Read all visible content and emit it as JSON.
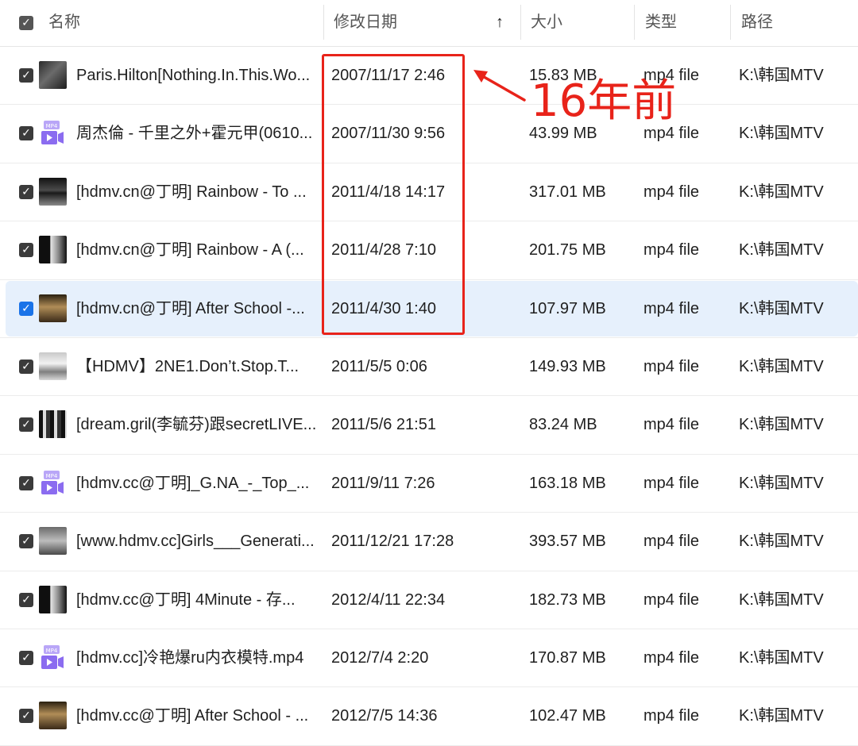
{
  "header": {
    "name": "名称",
    "date": "修改日期",
    "sort_arrow": "↑",
    "size": "大小",
    "type": "类型",
    "path": "路径"
  },
  "rows": [
    {
      "name": "Paris.Hilton[Nothing.In.This.Wo...",
      "date": "2007/11/17 2:46",
      "size": "15.83 MB",
      "type": "mp4 file",
      "path": "K:\\韩国MTV",
      "thumb": "dark",
      "selected": false
    },
    {
      "name": "周杰倫 - 千里之外+霍元甲(0610...",
      "date": "2007/11/30 9:56",
      "size": "43.99 MB",
      "type": "mp4 file",
      "path": "K:\\韩国MTV",
      "thumb": "video-file-icon",
      "selected": false
    },
    {
      "name": "[hdmv.cn@丁明] Rainbow - To ...",
      "date": "2011/4/18 14:17",
      "size": "317.01 MB",
      "type": "mp4 file",
      "path": "K:\\韩国MTV",
      "thumb": "stage",
      "selected": false
    },
    {
      "name": "[hdmv.cn@丁明] Rainbow - A (...",
      "date": "2011/4/28 7:10",
      "size": "201.75 MB",
      "type": "mp4 file",
      "path": "K:\\韩国MTV",
      "thumb": "bw",
      "selected": false
    },
    {
      "name": "[hdmv.cn@丁明] After School -...",
      "date": "2011/4/30 1:40",
      "size": "107.97 MB",
      "type": "mp4 file",
      "path": "K:\\韩国MTV",
      "thumb": "warm",
      "selected": true
    },
    {
      "name": "【HDMV】2NE1.Don’t.Stop.T...",
      "date": "2011/5/5 0:06",
      "size": "149.93 MB",
      "type": "mp4 file",
      "path": "K:\\韩国MTV",
      "thumb": "light",
      "selected": false
    },
    {
      "name": "[dream.gril(李毓芬)跟secretLIVE...",
      "date": "2011/5/6 21:51",
      "size": "83.24 MB",
      "type": "mp4 file",
      "path": "K:\\韩国MTV",
      "thumb": "bars",
      "selected": false
    },
    {
      "name": "[hdmv.cc@丁明]_G.NA_-_Top_...",
      "date": "2011/9/11 7:26",
      "size": "163.18 MB",
      "type": "mp4 file",
      "path": "K:\\韩国MTV",
      "thumb": "video-file-icon",
      "selected": false
    },
    {
      "name": "[www.hdmv.cc]Girls___Generati...",
      "date": "2011/12/21 17:28",
      "size": "393.57 MB",
      "type": "mp4 file",
      "path": "K:\\韩国MTV",
      "thumb": "grey",
      "selected": false
    },
    {
      "name": "[hdmv.cc@丁明] 4Minute - 存...",
      "date": "2012/4/11 22:34",
      "size": "182.73 MB",
      "type": "mp4 file",
      "path": "K:\\韩国MTV",
      "thumb": "bw",
      "selected": false
    },
    {
      "name": "[hdmv.cc]冷艳爆ru内衣模特.mp4",
      "date": "2012/7/4 2:20",
      "size": "170.87 MB",
      "type": "mp4 file",
      "path": "K:\\韩国MTV",
      "thumb": "video-file-icon",
      "selected": false
    },
    {
      "name": "[hdmv.cc@丁明] After School - ...",
      "date": "2012/7/5 14:36",
      "size": "102.47 MB",
      "type": "mp4 file",
      "path": "K:\\韩国MTV",
      "thumb": "warm",
      "selected": false
    }
  ],
  "annotation": {
    "text": "16年前",
    "color": "#e8231a"
  },
  "colors": {
    "selected_row_bg": "#e6f0fc",
    "checkbox_checked": "#3b3b3b",
    "checkbox_selected": "#1a73e8",
    "video_icon_purple": "#8b6cf0"
  }
}
